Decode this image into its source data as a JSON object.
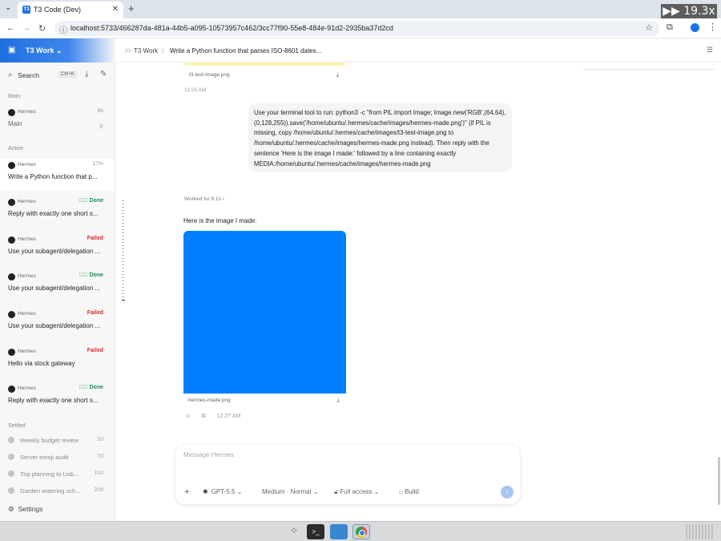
{
  "browser": {
    "tab_title": "T3 Code (Dev)",
    "url": "localhost:5733/466287da-481a-44b5-a095-10573957c462/3cc77f90-55e8-484e-91d2-2935ba37d2cd",
    "speed_indicator": "▶▶ 19.3x"
  },
  "sidebar": {
    "workspace": "T3 Work",
    "search_label": "Search",
    "search_shortcut": "Ctrl+K",
    "section_main": "Main",
    "section_active": "Active",
    "section_settled": "Settled",
    "main_thread": {
      "agent": "Hermes",
      "time": "8s",
      "title": "Main"
    },
    "active_threads": [
      {
        "agent": "Hermes",
        "status": "17m",
        "status_kind": "time",
        "title": "Write a Python function that p..."
      },
      {
        "agent": "Hermes",
        "status": "Done",
        "status_kind": "done",
        "title": "Reply with exactly one short s..."
      },
      {
        "agent": "Hermes",
        "status": "Failed",
        "status_kind": "failed",
        "title": "Use your subagent/delegation ..."
      },
      {
        "agent": "Hermes",
        "status": "Done",
        "status_kind": "done",
        "title": "Use your subagent/delegation ..."
      },
      {
        "agent": "Hermes",
        "status": "Failed",
        "status_kind": "failed",
        "title": "Use your subagent/delegation ..."
      },
      {
        "agent": "Hermes",
        "status": "Failed",
        "status_kind": "failed",
        "title": "Hello via stock gateway"
      },
      {
        "agent": "Hermes",
        "status": "Done",
        "status_kind": "done",
        "title": "Reply with exactly one short s..."
      }
    ],
    "settled_threads": [
      {
        "title": "Weekly budget review",
        "age": "5d"
      },
      {
        "title": "Server emoji audit",
        "age": "7d"
      },
      {
        "title": "Trip planning to Lisb...",
        "age": "10d"
      },
      {
        "title": "Garden watering sch...",
        "age": "20d"
      }
    ],
    "settings_label": "Settings"
  },
  "header": {
    "crumb_workspace": "T3 Work",
    "crumb_separator": "/",
    "crumb_thread": "Write a Python function that parses ISO-8601 dates..."
  },
  "chat": {
    "prev_attachment": "t3-test-image.png",
    "prev_time": "12:25 AM",
    "user_message": "Use your terminal tool to run: python3 -c \"from PIL import Image; Image.new('RGB',(64,64),(0,128,255)).save('/home/ubuntu/.hermes/cache/images/hermes-made.png')\" (if PIL is missing, copy /home/ubuntu/.hermes/cache/images/t3-test-image.png to /home/ubuntu/.hermes/cache/images/hermes-made.png instead). Then reply with the sentence 'Here is the image I made:' followed by a line containing exactly MEDIA:/home/ubuntu/.hermes/cache/images/hermes-made.png",
    "worked_label": "Worked for 9.1s",
    "assistant_text": "Here is the image I made:",
    "image_color": "#0080ff",
    "image_filename": "hermes-made.png",
    "reply_time": "12:27 AM"
  },
  "composer": {
    "placeholder": "Message Hermes",
    "model": "GPT-5.5",
    "reasoning": "Medium · Normal",
    "access": "Full access",
    "mode": "Build"
  },
  "colors": {
    "accent": "#1f6fe0",
    "done": "#1a8f4c",
    "failed": "#d62d2d"
  }
}
